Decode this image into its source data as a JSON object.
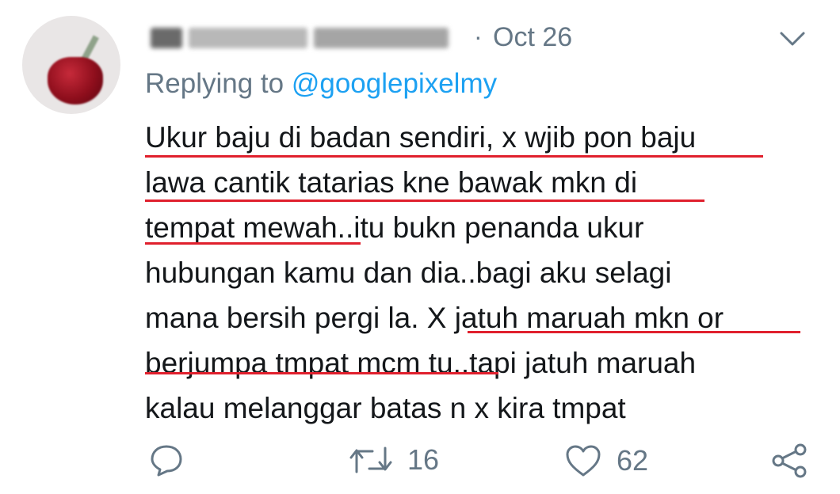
{
  "tweet": {
    "date": "Oct 26",
    "separator": "·",
    "reply_prefix": "Replying to",
    "reply_handle": "@googlepixelmy",
    "lines": [
      "Ukur baju di badan sendiri, x wjib pon baju",
      "lawa cantik tatarias kne bawak mkn di",
      "tempat mewah..itu bukn penanda ukur",
      "hubungan kamu dan dia..bagi aku selagi",
      "mana bersih  pergi la. X jatuh maruah mkn or",
      "berjumpa tmpat mcm tu..tapi jatuh maruah",
      "kalau melanggar batas n x kira tmpat"
    ]
  },
  "actions": {
    "retweet_count": "16",
    "like_count": "62"
  },
  "icons": {
    "reply": "speech-bubble-icon",
    "retweet": "retweet-arrows-icon",
    "like": "heart-icon",
    "share": "share-icon",
    "menu": "chevron-down-icon"
  },
  "colors": {
    "text": "#14171a",
    "secondary": "#657786",
    "link": "#1da1f2",
    "annotation": "#e0202d"
  }
}
